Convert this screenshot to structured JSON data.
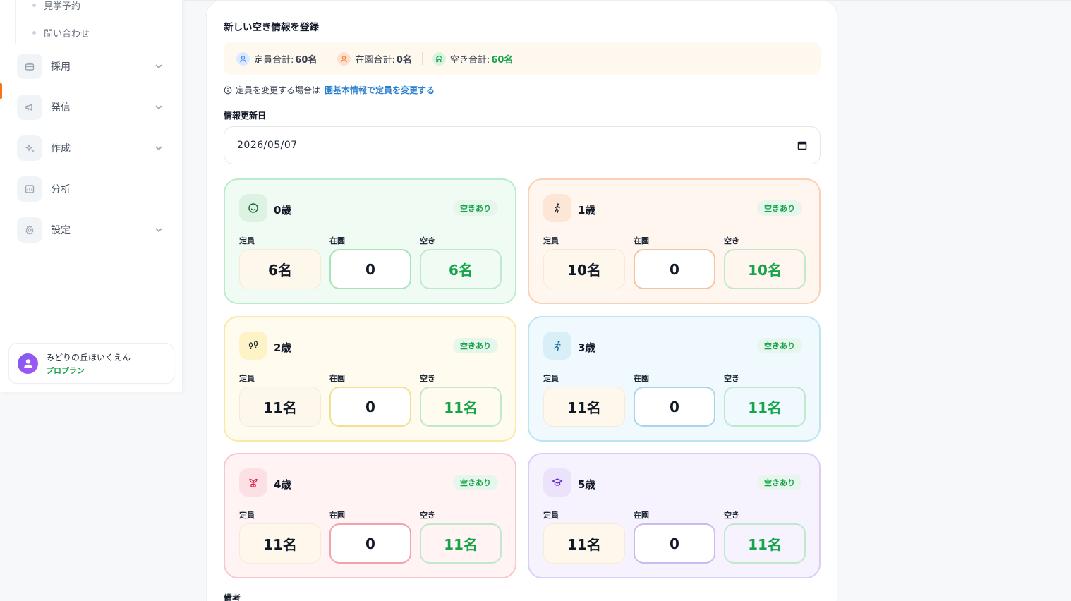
{
  "sidebar": {
    "sub_items": [
      "見学予約",
      "問い合わせ"
    ],
    "nav": [
      {
        "label": "採用",
        "icon": "briefcase-icon",
        "chevron": true
      },
      {
        "label": "発信",
        "icon": "megaphone-icon",
        "chevron": true
      },
      {
        "label": "作成",
        "icon": "sparkle-icon",
        "chevron": true
      },
      {
        "label": "分析",
        "icon": "chart-icon",
        "chevron": false
      },
      {
        "label": "設定",
        "icon": "gear-icon",
        "chevron": true
      }
    ],
    "user": {
      "name": "みどりの丘ほいくえん",
      "plan": "プロプラン"
    }
  },
  "form": {
    "title": "新しい空き情報を登録",
    "summary": {
      "capacity_label": "定員合計:",
      "capacity_value": "60名",
      "enrolled_label": "在園合計:",
      "enrolled_value": "0名",
      "vacancy_label": "空き合計:",
      "vacancy_value": "60名"
    },
    "note_text": "定員を変更する場合は",
    "note_link": "園基本情報で定員を変更する",
    "date_label": "情報更新日",
    "date_value": "2026/05/07",
    "remarks_label": "備考",
    "col_labels": {
      "capacity": "定員",
      "enrolled": "在園",
      "vacancy": "空き"
    },
    "ages": [
      {
        "title": "0歳",
        "badge": "空きあり",
        "capacity": "6名",
        "enrolled": "0",
        "vacancy": "6名",
        "icon": "smile-icon"
      },
      {
        "title": "1歳",
        "badge": "空きあり",
        "capacity": "10名",
        "enrolled": "0",
        "vacancy": "10名",
        "icon": "walking-icon"
      },
      {
        "title": "2歳",
        "badge": "空きあり",
        "capacity": "11名",
        "enrolled": "0",
        "vacancy": "11名",
        "icon": "footprints-icon"
      },
      {
        "title": "3歳",
        "badge": "空きあり",
        "capacity": "11名",
        "enrolled": "0",
        "vacancy": "11名",
        "icon": "running-icon"
      },
      {
        "title": "4歳",
        "badge": "空きあり",
        "capacity": "11名",
        "enrolled": "0",
        "vacancy": "11名",
        "icon": "sprout-icon"
      },
      {
        "title": "5歳",
        "badge": "空きあり",
        "capacity": "11名",
        "enrolled": "0",
        "vacancy": "11名",
        "icon": "graduation-cap-icon"
      }
    ]
  },
  "colors": {
    "accent_orange": "#f97316",
    "vacancy_green": "#16a34a",
    "link_blue": "#2b7fd0",
    "card_themes": [
      {
        "bg": "#f0fbf4",
        "border": "#b9ecca",
        "icon_bg": "#dcf3e4",
        "enrolled_border": "#a7e3bb"
      },
      {
        "bg": "#fff6f0",
        "border": "#fbd0b4",
        "icon_bg": "#fde6d6",
        "enrolled_border": "#f7c4a2"
      },
      {
        "bg": "#fffcef",
        "border": "#fae9a6",
        "icon_bg": "#fdf3c7",
        "enrolled_border": "#f1df96"
      },
      {
        "bg": "#f0f9fd",
        "border": "#bde4f3",
        "icon_bg": "#d9eff8",
        "enrolled_border": "#a7d6ea"
      },
      {
        "bg": "#fff3f4",
        "border": "#f8c6cb",
        "icon_bg": "#fde0e3",
        "enrolled_border": "#f1a3ac"
      },
      {
        "bg": "#f7f3fe",
        "border": "#dccdf7",
        "icon_bg": "#ebe2fb",
        "enrolled_border": "#cdbbf0"
      }
    ]
  }
}
